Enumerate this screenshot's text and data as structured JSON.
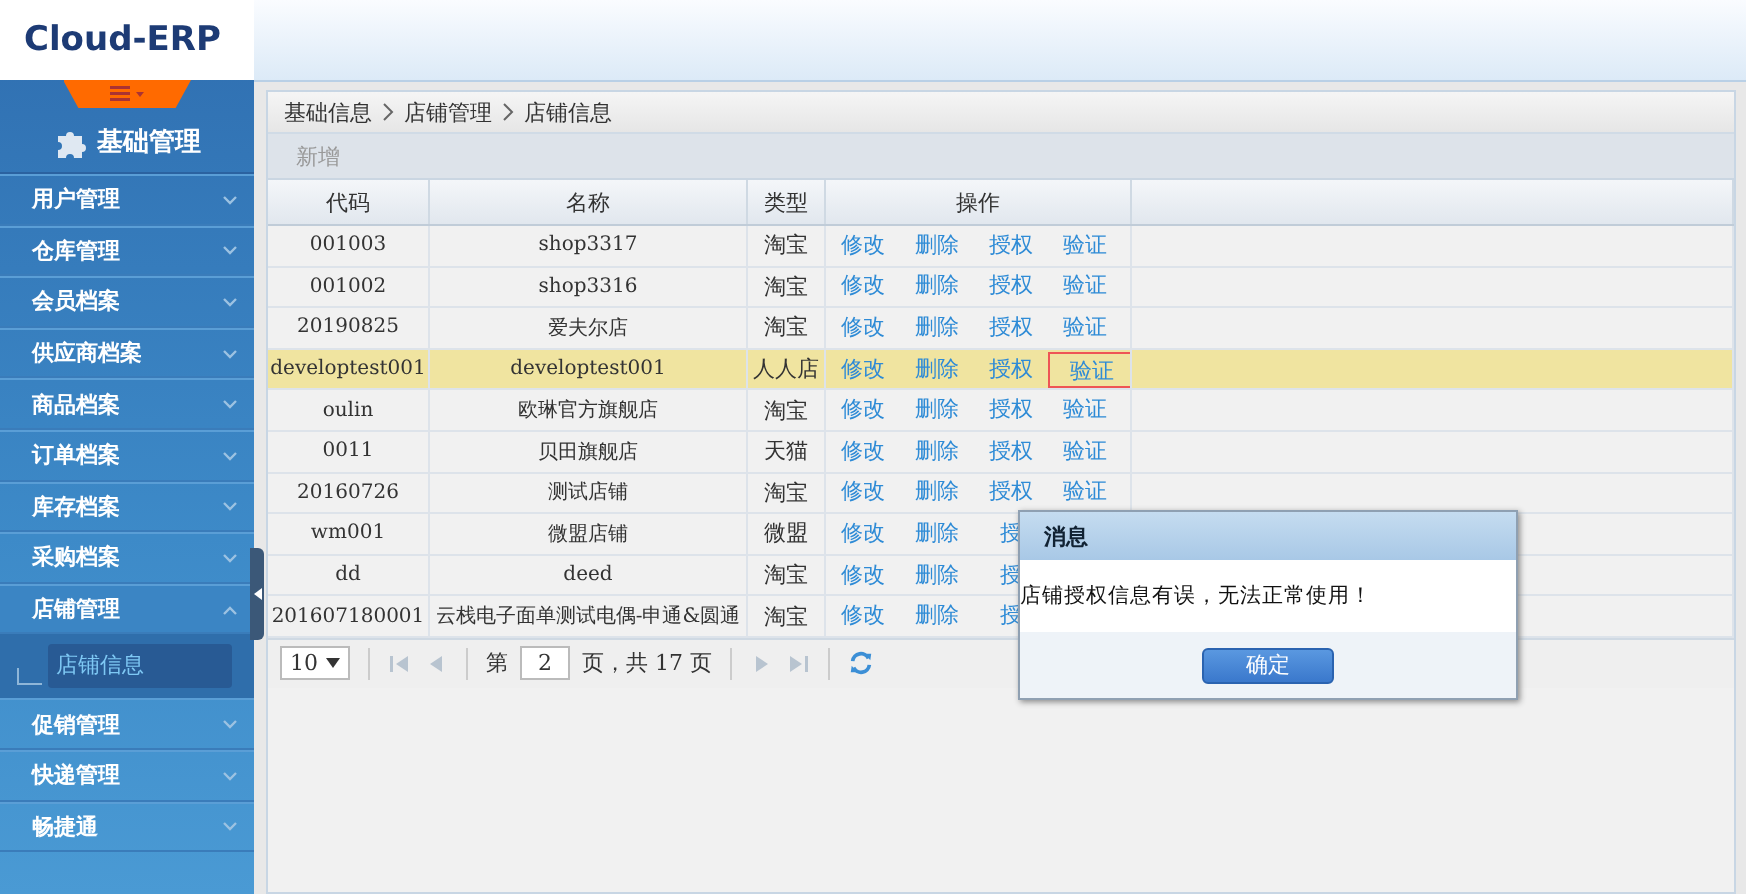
{
  "app": {
    "logo": "Cloud-ERP"
  },
  "sidebar": {
    "heading": "基础管理",
    "items": [
      {
        "label": "用户管理",
        "expanded": false
      },
      {
        "label": "仓库管理",
        "expanded": false
      },
      {
        "label": "会员档案",
        "expanded": false
      },
      {
        "label": "供应商档案",
        "expanded": false
      },
      {
        "label": "商品档案",
        "expanded": false
      },
      {
        "label": "订单档案",
        "expanded": false
      },
      {
        "label": "库存档案",
        "expanded": false
      },
      {
        "label": "采购档案",
        "expanded": false
      },
      {
        "label": "店铺管理",
        "expanded": true,
        "children": [
          {
            "label": "店铺信息",
            "selected": true
          }
        ]
      },
      {
        "label": "促销管理",
        "expanded": false
      },
      {
        "label": "快递管理",
        "expanded": false
      },
      {
        "label": "畅捷通",
        "expanded": false
      }
    ]
  },
  "breadcrumb": [
    "基础信息",
    "店铺管理",
    "店铺信息"
  ],
  "toolbar": {
    "add_button": "新增"
  },
  "table": {
    "columns": [
      "代码",
      "名称",
      "类型",
      "操作"
    ],
    "rows": [
      {
        "code": "001003",
        "name": "shop3317",
        "type": "淘宝",
        "selected": false,
        "actions": [
          {
            "label": "修改",
            "outlined": false
          },
          {
            "label": "删除",
            "outlined": false
          },
          {
            "label": "授权",
            "outlined": false
          },
          {
            "label": "验证",
            "outlined": false
          }
        ]
      },
      {
        "code": "001002",
        "name": "shop3316",
        "type": "淘宝",
        "selected": false,
        "actions": [
          {
            "label": "修改",
            "outlined": false
          },
          {
            "label": "删除",
            "outlined": false
          },
          {
            "label": "授权",
            "outlined": false
          },
          {
            "label": "验证",
            "outlined": false
          }
        ]
      },
      {
        "code": "20190825",
        "name": "爱夫尔店",
        "type": "淘宝",
        "selected": false,
        "actions": [
          {
            "label": "修改",
            "outlined": false
          },
          {
            "label": "删除",
            "outlined": false
          },
          {
            "label": "授权",
            "outlined": false
          },
          {
            "label": "验证",
            "outlined": false
          }
        ]
      },
      {
        "code": "developtest001",
        "name": "developtest001",
        "type": "人人店",
        "selected": true,
        "actions": [
          {
            "label": "修改",
            "outlined": false
          },
          {
            "label": "删除",
            "outlined": false
          },
          {
            "label": "授权",
            "outlined": false
          },
          {
            "label": "验证",
            "outlined": true
          }
        ]
      },
      {
        "code": "oulin",
        "name": "欧琳官方旗舰店",
        "type": "淘宝",
        "selected": false,
        "actions": [
          {
            "label": "修改",
            "outlined": false
          },
          {
            "label": "删除",
            "outlined": false
          },
          {
            "label": "授权",
            "outlined": false
          },
          {
            "label": "验证",
            "outlined": false
          }
        ]
      },
      {
        "code": "0011",
        "name": "贝田旗舰店",
        "type": "天猫",
        "selected": false,
        "actions": [
          {
            "label": "修改",
            "outlined": false
          },
          {
            "label": "删除",
            "outlined": false
          },
          {
            "label": "授权",
            "outlined": false
          },
          {
            "label": "验证",
            "outlined": false
          }
        ]
      },
      {
        "code": "20160726",
        "name": "测试店铺",
        "type": "淘宝",
        "selected": false,
        "actions": [
          {
            "label": "修改",
            "outlined": false
          },
          {
            "label": "删除",
            "outlined": false
          },
          {
            "label": "授权",
            "outlined": false
          },
          {
            "label": "验证",
            "outlined": false
          }
        ]
      },
      {
        "code": "wm001",
        "name": "微盟店铺",
        "type": "微盟",
        "selected": false,
        "actions": [
          {
            "label": "修改",
            "outlined": false
          },
          {
            "label": "删除",
            "outlined": false
          },
          {
            "label": "授",
            "outlined": false
          }
        ]
      },
      {
        "code": "dd",
        "name": "deed",
        "type": "淘宝",
        "selected": false,
        "actions": [
          {
            "label": "修改",
            "outlined": false
          },
          {
            "label": "删除",
            "outlined": false
          },
          {
            "label": "授",
            "outlined": false
          }
        ]
      },
      {
        "code": "201607180001",
        "name": "云栈电子面单测试电偶-申通&圆通",
        "type": "淘宝",
        "selected": false,
        "actions": [
          {
            "label": "修改",
            "outlined": false
          },
          {
            "label": "删除",
            "outlined": false
          },
          {
            "label": "授",
            "outlined": false
          }
        ]
      }
    ]
  },
  "pager": {
    "page_size": "10",
    "before": "第",
    "page": "2",
    "after": "页，共 17 页"
  },
  "dialog": {
    "title": "消息",
    "message": "店铺授权信息有误，无法正常使用！",
    "ok_button": "确定"
  }
}
